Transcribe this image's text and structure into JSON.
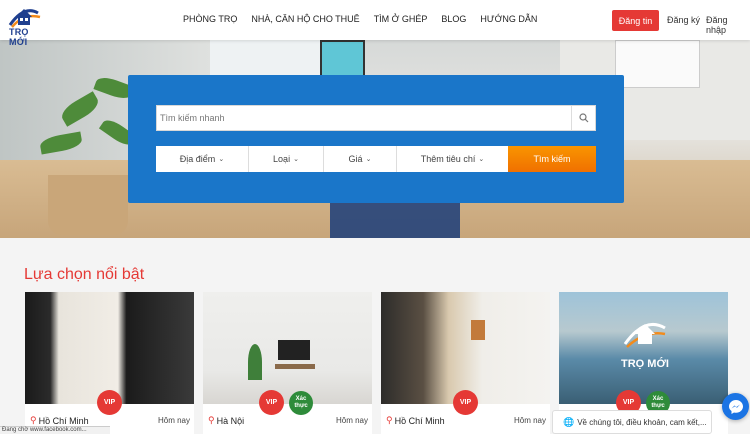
{
  "header": {
    "logo_text": "TRỌ MỚI",
    "nav": [
      "PHÒNG TRỌ",
      "NHÀ, CĂN HỘ CHO THUÊ",
      "TÌM Ở GHÉP",
      "BLOG",
      "HƯỚNG DẪN"
    ],
    "post_button": "Đăng tin",
    "register": "Đăng ký",
    "login": "Đăng nhập"
  },
  "search": {
    "placeholder": "Tìm kiếm nhanh",
    "filters": [
      "Địa điểm",
      "Loại",
      "Giá",
      "Thêm tiêu chí"
    ],
    "button": "Tìm kiếm"
  },
  "featured": {
    "title": "Lựa chọn nổi bật",
    "cards": [
      {
        "location": "Hồ Chí Minh",
        "date": "Hôm nay",
        "vip": "VIP",
        "verified": ""
      },
      {
        "location": "Hà Nội",
        "date": "Hôm nay",
        "vip": "VIP",
        "verified": "Xác thực"
      },
      {
        "location": "Hồ Chí Minh",
        "date": "Hôm nay",
        "vip": "VIP",
        "verified": ""
      },
      {
        "location": "",
        "date": "",
        "vip": "VIP",
        "verified": "Xác thực",
        "logo_text": "TRỌ MỚI"
      }
    ]
  },
  "cookie_notice": "Về chúng tôi, điều khoản, cam kết,...",
  "status_url": "Đang chờ www.facebook.com...",
  "colors": {
    "accent": "#e53935",
    "panel": "#1a76c9",
    "search_button": "#f07000",
    "verified": "#2e8b3a"
  }
}
